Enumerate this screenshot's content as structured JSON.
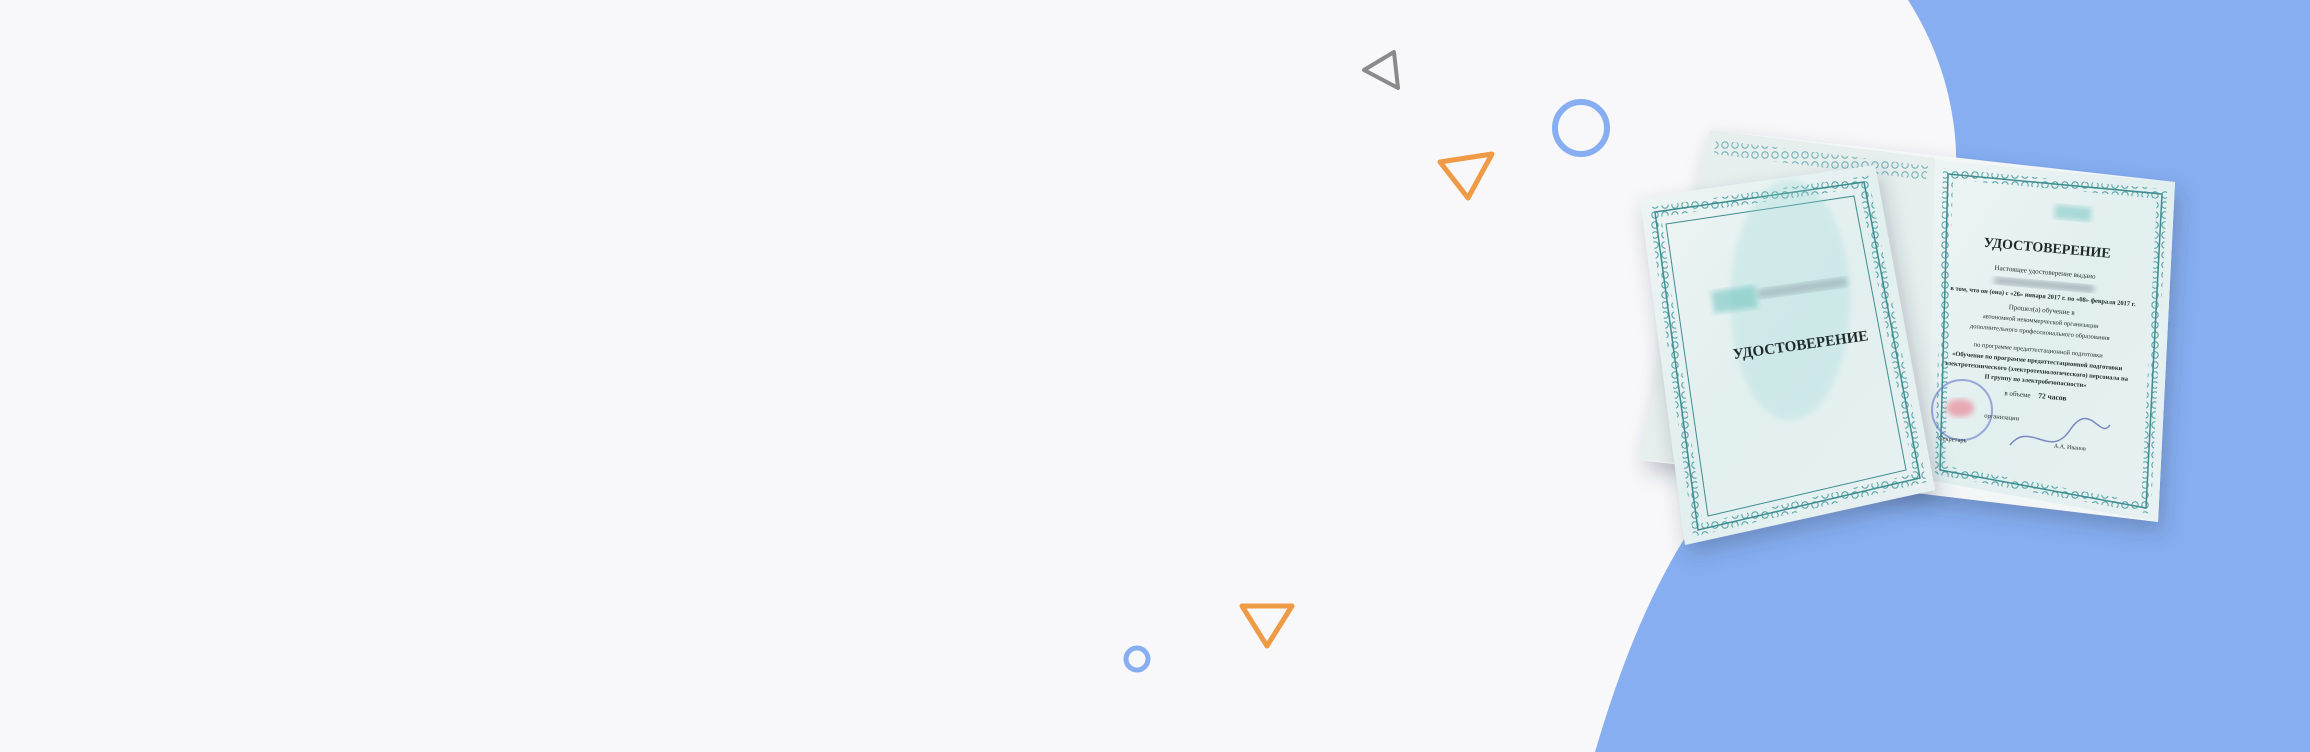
{
  "colors": {
    "background": "#f8f8fa",
    "blob": "#86aef0",
    "shape_gray": "#8a8a8a",
    "shape_orange": "#ef9a45",
    "shape_blue": "#86aef0"
  },
  "certificate": {
    "cover_title": "УДОСТОВЕРЕНИЕ",
    "inner_title": "УДОСТОВЕРЕНИЕ",
    "line_1": "Настоящее удостоверение выдано",
    "line_3": "в том, что он (она) с «26» января 2017 г. по «08» февраля 2017 г.",
    "line_4": "Прошел(а) обучение в",
    "line_5": "автономной некоммерческой организации",
    "line_6": "дополнительного профессионального образования",
    "line_7": "по программе предаттестационной подготовки",
    "line_8": "«Обучение по программе предаттестационной подготовки",
    "line_9": "электротехнического (электротехнологического) персонала на",
    "line_10": "II группу по электробезопасности»",
    "hours_prefix": "в объеме",
    "hours_value": "72 часов",
    "org_label": "организации",
    "secretary_label": "Секретарь",
    "signature_name": "А.А. Иванов"
  }
}
